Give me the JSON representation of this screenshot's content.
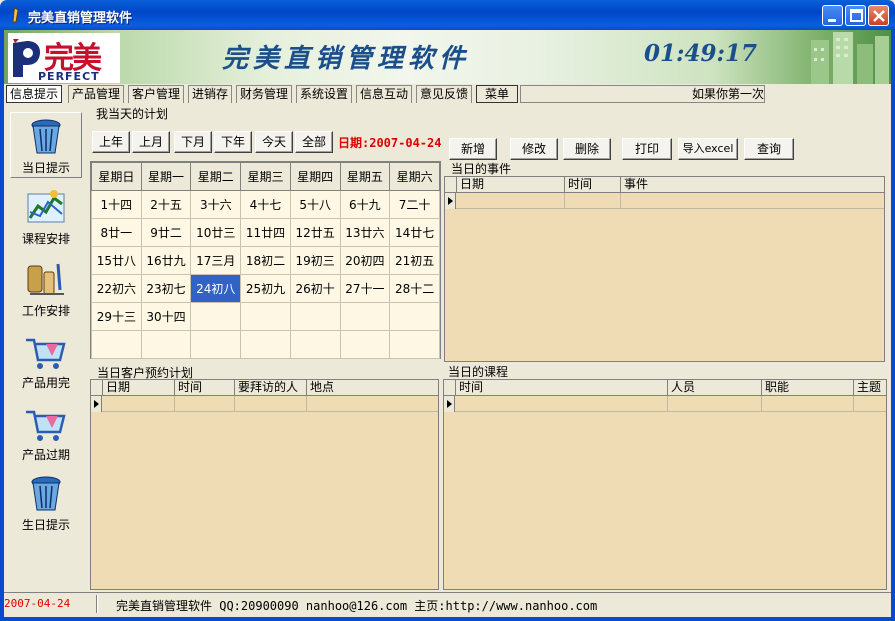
{
  "window": {
    "title": "完美直销管理软件"
  },
  "banner": {
    "logo_cn": "完美",
    "logo_en": "PERFECT",
    "title": "完美直销管理软件",
    "clock": "01:49:17"
  },
  "menu": {
    "items": [
      "信息提示",
      "产品管理",
      "客户管理",
      "进销存",
      "财务管理",
      "系统设置",
      "信息互动",
      "意见反馈",
      "菜单"
    ],
    "marquee": "如果你第一次"
  },
  "sidebar": {
    "items": [
      {
        "label": "当日提示",
        "icon": "trash-bin-icon"
      },
      {
        "label": "课程安排",
        "icon": "chart-icon"
      },
      {
        "label": "工作安排",
        "icon": "tools-icon"
      },
      {
        "label": "产品用完",
        "icon": "cart-icon"
      },
      {
        "label": "产品过期",
        "icon": "cart-expired-icon"
      },
      {
        "label": "生日提示",
        "icon": "trash-bin-icon"
      }
    ]
  },
  "plan": {
    "legend": "我当天的计划",
    "nav_buttons": [
      "上年",
      "上月",
      "下月",
      "下年",
      "今天",
      "全部"
    ],
    "date_label": "日期:2007-04-24",
    "action_buttons": [
      "新增",
      "修改",
      "删除",
      "打印",
      "导入excel",
      "查询"
    ]
  },
  "calendar": {
    "weekdays": [
      "星期日",
      "星期一",
      "星期二",
      "星期三",
      "星期四",
      "星期五",
      "星期六"
    ],
    "weeks": [
      [
        "1十四",
        "2十五",
        "3十六",
        "4十七",
        "5十八",
        "6十九",
        "7二十"
      ],
      [
        "8廿一",
        "9廿二",
        "10廿三",
        "11廿四",
        "12廿五",
        "13廿六",
        "14廿七"
      ],
      [
        "15廿八",
        "16廿九",
        "17三月",
        "18初二",
        "19初三",
        "20初四",
        "21初五"
      ],
      [
        "22初六",
        "23初七",
        "24初八",
        "25初九",
        "26初十",
        "27十一",
        "28十二"
      ],
      [
        "29十三",
        "30十四",
        "",
        "",
        "",
        "",
        ""
      ],
      [
        "",
        "",
        "",
        "",
        "",
        "",
        ""
      ]
    ],
    "selected": "24初八"
  },
  "events_panel": {
    "legend": "当日的事件",
    "columns": [
      "日期",
      "时间",
      "事件"
    ]
  },
  "visits_panel": {
    "legend": "当日客户预约计划",
    "columns": [
      "日期",
      "时间",
      "要拜访的人",
      "地点"
    ]
  },
  "courses_panel": {
    "legend": "当日的课程",
    "columns": [
      "时间",
      "人员",
      "职能",
      "主题"
    ]
  },
  "status": {
    "date": "2007-04-24",
    "text": "完美直销管理软件 QQ:20900090 nanhoo@126.com 主页:http://www.nanhoo.com"
  },
  "colors": {
    "title_bar": "#0a5fd8",
    "date_red": "#e00000",
    "selected_cell": "#3163c5",
    "grid_bg": "#efdcb5"
  }
}
